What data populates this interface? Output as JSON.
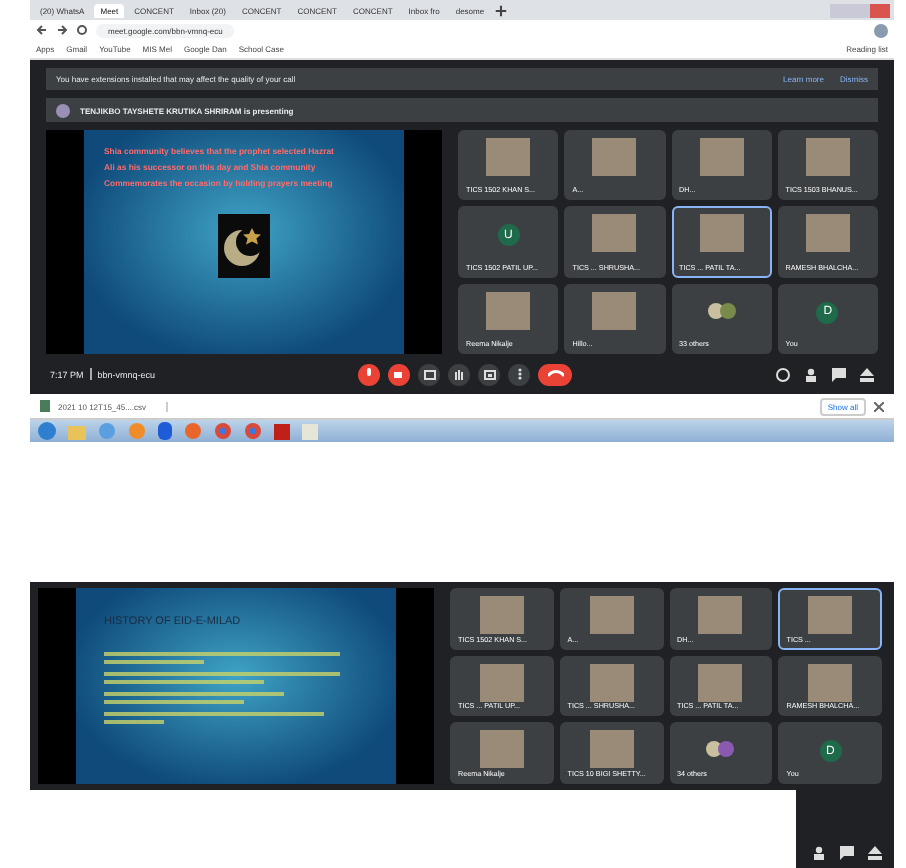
{
  "browser": {
    "tabs": [
      {
        "label": "(20) WhatsA",
        "selected": false
      },
      {
        "label": "Meet",
        "selected": true
      },
      {
        "label": "CONCENT",
        "selected": false
      },
      {
        "label": "Inbox (20)",
        "selected": false
      },
      {
        "label": "CONCENT",
        "selected": false
      },
      {
        "label": "CONCENT",
        "selected": false
      },
      {
        "label": "CONCENT",
        "selected": false
      },
      {
        "label": "Inbox fro",
        "selected": false
      },
      {
        "label": "desome",
        "selected": false
      }
    ],
    "address": "meet.google.com/bbn-vmnq-ecu",
    "bookmarks": [
      "Apps",
      "Gmail",
      "YouTube",
      "MIS Mel",
      "Google Dan",
      "School Case"
    ],
    "reading_list": "Reading list"
  },
  "meet_top": {
    "banner": {
      "text": "You have extensions installed that may affect the quality of your call",
      "learn_more": "Learn more",
      "dismiss": "Dismiss"
    },
    "presenter": "TENJIKBO TAYSHETE KRUTIKA SHRIRAM is presenting",
    "slide": {
      "lines": [
        "Shia community believes that the prophet selected Hazrat",
        "Ali as his successor on this day and Shia community",
        "Commemorates the occasion by holding prayers meeting"
      ]
    },
    "tiles": [
      {
        "name": "TICS 1502 KHAN S...",
        "kind": "video",
        "highlighted": false
      },
      {
        "name": "A...",
        "kind": "video",
        "highlighted": false
      },
      {
        "name": "DH...",
        "kind": "video",
        "highlighted": false
      },
      {
        "name": "TICS 1503 BHANUS...",
        "kind": "video",
        "highlighted": false
      },
      {
        "name": "TICS 1502 PATIL UP...",
        "kind": "letter",
        "initial": "U",
        "highlighted": false
      },
      {
        "name": "TICS ... SHRUSHA...",
        "kind": "video",
        "highlighted": false
      },
      {
        "name": "TICS ... PATIL TA...",
        "kind": "video",
        "highlighted": true
      },
      {
        "name": "RAMESH BHALCHA...",
        "kind": "video",
        "highlighted": false
      },
      {
        "name": "Reema Nikalje",
        "kind": "video",
        "highlighted": false
      },
      {
        "name": "Hillo...",
        "kind": "video",
        "highlighted": false
      },
      {
        "name": "33 others",
        "kind": "others",
        "highlighted": false
      },
      {
        "name": "You",
        "kind": "letter",
        "initial": "D",
        "highlighted": false
      }
    ],
    "time": "7:17 PM",
    "meeting_code": "bbn-vmnq-ecu"
  },
  "download_bar": {
    "file": "2021 10 12T15_45....csv",
    "show_all": "Show all"
  },
  "meet_bottom": {
    "slide": {
      "title": "HISTORY OF EID-E-MILAD"
    },
    "tiles": [
      {
        "name": "TICS 1502 KHAN S...",
        "kind": "video",
        "highlighted": false
      },
      {
        "name": "A...",
        "kind": "video",
        "highlighted": false
      },
      {
        "name": "DH...",
        "kind": "video",
        "highlighted": false
      },
      {
        "name": "TICS ...",
        "kind": "video",
        "highlighted": true
      },
      {
        "name": "TICS ... PATIL UP...",
        "kind": "video",
        "highlighted": false
      },
      {
        "name": "TICS ... SHRUSHA...",
        "kind": "video",
        "highlighted": false
      },
      {
        "name": "TICS ... PATIL TA...",
        "kind": "video",
        "highlighted": false
      },
      {
        "name": "RAMESH BHALCHA...",
        "kind": "video",
        "highlighted": false
      },
      {
        "name": "Reema Nikalje",
        "kind": "video",
        "highlighted": false
      },
      {
        "name": "TICS 10 BIGI SHETTY...",
        "kind": "video",
        "highlighted": false
      },
      {
        "name": "34 others",
        "kind": "others",
        "highlighted": false
      },
      {
        "name": "You",
        "kind": "letter",
        "initial": "D",
        "highlighted": false
      }
    ]
  }
}
